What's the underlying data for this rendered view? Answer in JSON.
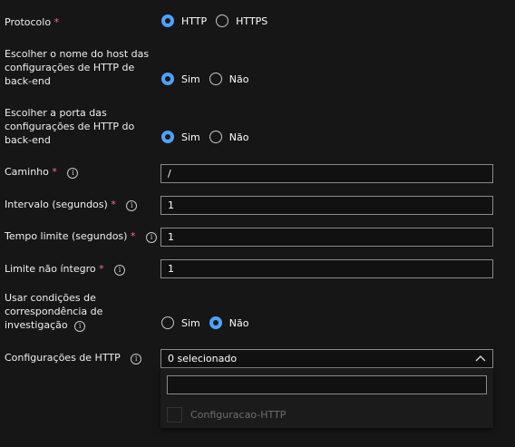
{
  "form": {
    "protocol": {
      "label": "Protocolo",
      "required": "*",
      "options": [
        {
          "label": "HTTP",
          "checked": true
        },
        {
          "label": "HTTPS",
          "checked": false
        }
      ]
    },
    "host": {
      "label": "Escolher o nome do host das configurações de HTTP de back-end",
      "options": [
        {
          "label": "Sim",
          "checked": true
        },
        {
          "label": "Não",
          "checked": false
        }
      ]
    },
    "port": {
      "label": "Escolher a porta das configurações de HTTP do back-end",
      "options": [
        {
          "label": "Sim",
          "checked": true
        },
        {
          "label": "Não",
          "checked": false
        }
      ]
    },
    "path": {
      "label": "Caminho",
      "required": "*",
      "value": "/"
    },
    "interval": {
      "label": "Intervalo (segundos)",
      "required": "*",
      "value": "1"
    },
    "timeout": {
      "label": "Tempo limite (segundos)",
      "required": "*",
      "value": "1"
    },
    "unhealthy": {
      "label": "Limite não íntegro",
      "required": "*",
      "value": "1"
    },
    "match": {
      "label": "Usar condições de correspondência de investigação",
      "options": [
        {
          "label": "Sim",
          "checked": false
        },
        {
          "label": "Não",
          "checked": true
        }
      ]
    },
    "http_settings": {
      "label": "Configurações de HTTP",
      "value": "0 selecionado",
      "search_value": "",
      "options": [
        {
          "label": "Configuracao-HTTP",
          "checked": false
        }
      ]
    }
  },
  "icons": {
    "info": "i",
    "info_name": "info-icon",
    "chevron": "chevron-up-icon"
  },
  "colors": {
    "background": "#161616",
    "accent": "#4fa1ff",
    "required": "#f1707b",
    "border": "#8a8a8a",
    "disabled_text": "#6e6e6e"
  }
}
